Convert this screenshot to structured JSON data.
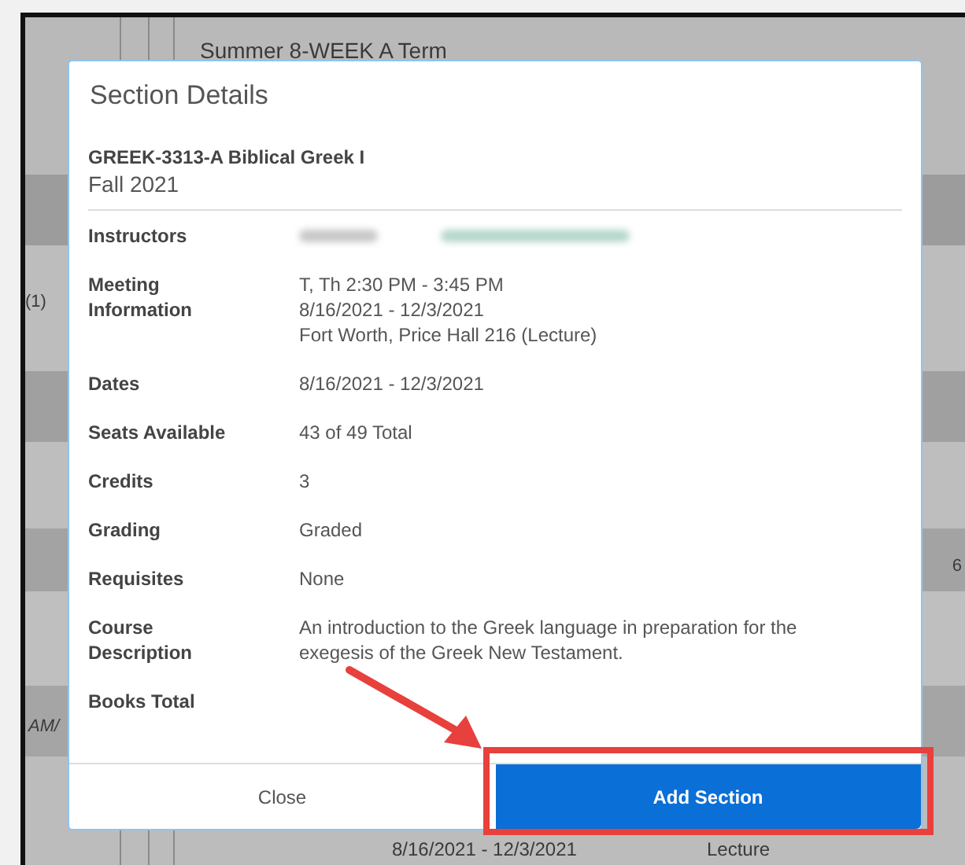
{
  "background": {
    "term_heading": "Summer 8-WEEK A Term",
    "left_fragment": "(1)",
    "right_fragment": "6",
    "time_fragment": "AM/",
    "dates": "8/16/2021 - 12/3/2021",
    "type": "Lecture"
  },
  "modal": {
    "title": "Section Details",
    "course": "GREEK-3313-A Biblical Greek I",
    "term": "Fall 2021",
    "details": [
      {
        "label": "Instructors",
        "kind": "blurred"
      },
      {
        "label": "Meeting Information",
        "kind": "text",
        "lines": [
          "T, Th 2:30 PM - 3:45 PM",
          "8/16/2021 - 12/3/2021",
          "Fort Worth, Price Hall 216 (Lecture)"
        ]
      },
      {
        "label": "Dates",
        "kind": "text",
        "lines": [
          "8/16/2021 - 12/3/2021"
        ]
      },
      {
        "label": "Seats Available",
        "kind": "text",
        "lines": [
          "43 of 49 Total"
        ]
      },
      {
        "label": "Credits",
        "kind": "text",
        "lines": [
          "3"
        ]
      },
      {
        "label": "Grading",
        "kind": "text",
        "lines": [
          "Graded"
        ]
      },
      {
        "label": "Requisites",
        "kind": "text",
        "lines": [
          "None"
        ]
      },
      {
        "label": "Course Description",
        "kind": "text",
        "lines": [
          "An introduction to the Greek language in preparation for the exegesis of the Greek New Testament."
        ]
      },
      {
        "label": "Books Total",
        "kind": "text"
      }
    ],
    "buttons": [
      {
        "label": "Close",
        "kind": "secondary"
      },
      {
        "label": "Add Section",
        "kind": "primary"
      }
    ]
  }
}
